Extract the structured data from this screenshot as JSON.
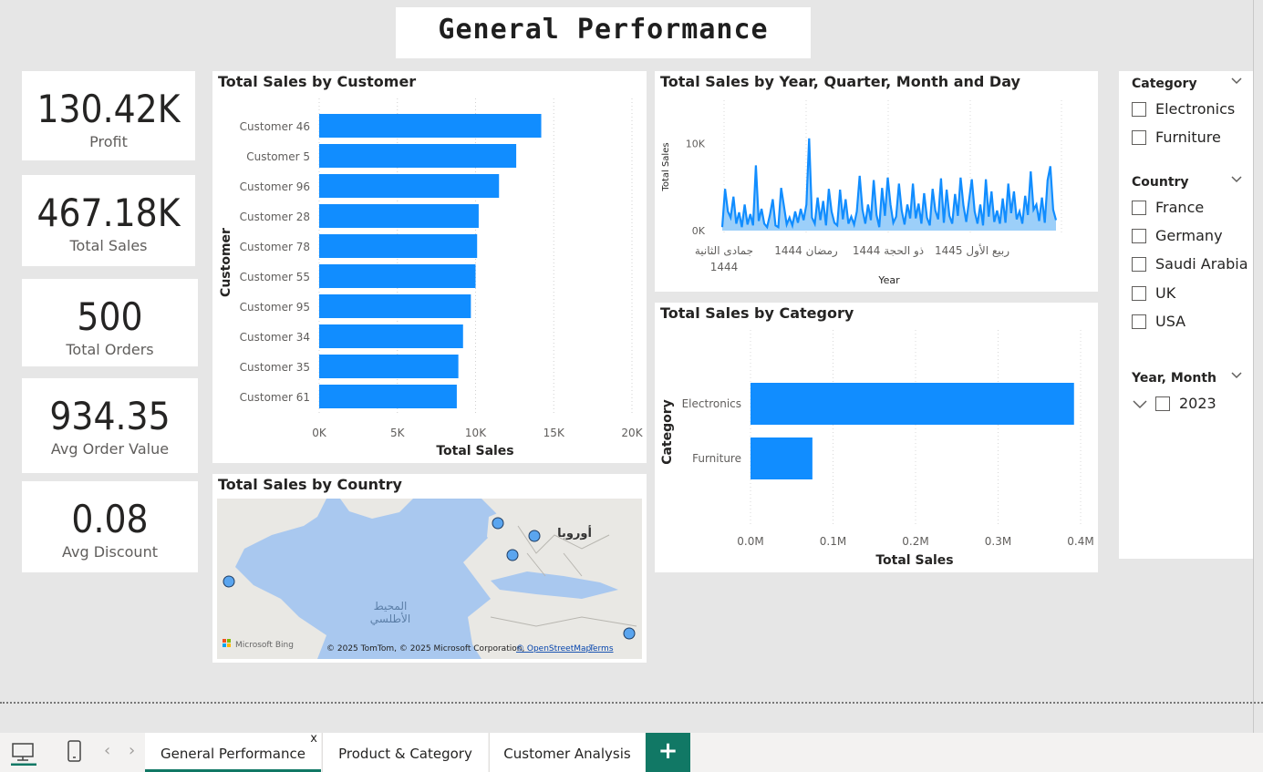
{
  "title": "General Performance",
  "kpis": [
    {
      "value": "130.42K",
      "label": "Profit"
    },
    {
      "value": "467.18K",
      "label": "Total Sales"
    },
    {
      "value": "500",
      "label": "Total Orders"
    },
    {
      "value": "934.35",
      "label": "Avg Order Value"
    },
    {
      "value": "0.08",
      "label": "Avg Discount"
    }
  ],
  "customer_chart": {
    "title": "Total Sales by Customer",
    "chart_data": {
      "type": "bar",
      "orientation": "horizontal",
      "categories": [
        "Customer 46",
        "Customer 5",
        "Customer 96",
        "Customer 28",
        "Customer 78",
        "Customer 55",
        "Customer 95",
        "Customer 34",
        "Customer 35",
        "Customer 61"
      ],
      "values": [
        14200,
        12600,
        11500,
        10200,
        10100,
        10000,
        9700,
        9200,
        8900,
        8800
      ],
      "xlabel": "Total Sales",
      "ylabel": "Customer",
      "xlim": [
        0,
        20000
      ],
      "ticks": [
        "0K",
        "5K",
        "10K",
        "15K",
        "20K"
      ],
      "grid": true,
      "color": "#118dff"
    }
  },
  "time_chart": {
    "title": "Total Sales by Year, Quarter, Month and Day",
    "chart_data": {
      "type": "area",
      "xlabel": "Year",
      "ylabel": "Total Sales",
      "yticks": [
        "10K",
        "0K"
      ],
      "ylim": [
        0,
        11000
      ],
      "xticks": [
        "جمادى الثانية",
        "1444",
        "رمضان 1444",
        "ذو الحجة 1444",
        "ربيع الأول 1445"
      ],
      "values": [
        400,
        4800,
        2200,
        1500,
        3900,
        800,
        2100,
        400,
        3000,
        700,
        1900,
        600,
        7500,
        1100,
        2500,
        800,
        400,
        1800,
        3600,
        600,
        400,
        4900,
        2800,
        700,
        1500,
        600,
        2200,
        900,
        2500,
        1200,
        3000,
        10600,
        1500,
        800,
        3800,
        1200,
        3400,
        600,
        4800,
        2200,
        900,
        600,
        4700,
        1300,
        3600,
        800,
        1600,
        700,
        2200,
        6300,
        2400,
        800,
        3000,
        1200,
        5800,
        1800,
        400,
        4900,
        1700,
        6100,
        3000,
        900,
        1600,
        5400,
        2300,
        700,
        3000,
        1400,
        5400,
        1400,
        3100,
        800,
        4300,
        1500,
        600,
        4800,
        2300,
        1300,
        6000,
        900,
        4700,
        1700,
        800,
        4200,
        1700,
        6100,
        2900,
        1000,
        3500,
        5900,
        2200,
        800,
        3000,
        600,
        5900,
        1600,
        4500,
        1000,
        2300,
        800,
        3700,
        900,
        5400,
        2000,
        4500,
        1300,
        2200,
        800,
        4000,
        1800,
        6800,
        2400,
        3000,
        1100,
        3800,
        900,
        5800,
        7400,
        2400,
        1200
      ],
      "color": "#118dff"
    }
  },
  "category_chart": {
    "title": "Total Sales by Category",
    "chart_data": {
      "type": "bar",
      "orientation": "horizontal",
      "categories": [
        "Electronics",
        "Furniture"
      ],
      "values": [
        392000,
        75000
      ],
      "xlabel": "Total Sales",
      "ylabel": "Category",
      "xlim": [
        0,
        400000
      ],
      "ticks": [
        "0.0M",
        "0.1M",
        "0.2M",
        "0.3M",
        "0.4M"
      ],
      "grid": true,
      "color": "#118dff"
    }
  },
  "map": {
    "title": "Total Sales by Country",
    "label_ocean_1": "المحيط",
    "label_ocean_2": "الأطلسي",
    "label_europe": "أوروبا",
    "bing": "Microsoft Bing",
    "copyright": "© 2025 TomTom, © 2025 Microsoft Corporation,",
    "osm": "© OpenStreetMap",
    "terms": "Terms"
  },
  "slicers": {
    "category": {
      "title": "Category",
      "items": [
        "Electronics",
        "Furniture"
      ]
    },
    "country": {
      "title": "Country",
      "items": [
        "France",
        "Germany",
        "Saudi Arabia",
        "UK",
        "USA"
      ]
    },
    "year_month": {
      "title": "Year, Month",
      "items": [
        "2023"
      ]
    }
  },
  "tabs": {
    "items": [
      "General Performance",
      "Product & Category",
      "Customer Analysis"
    ],
    "close": "x",
    "add": "+"
  },
  "nav": {
    "prev": "‹",
    "next": "›"
  }
}
